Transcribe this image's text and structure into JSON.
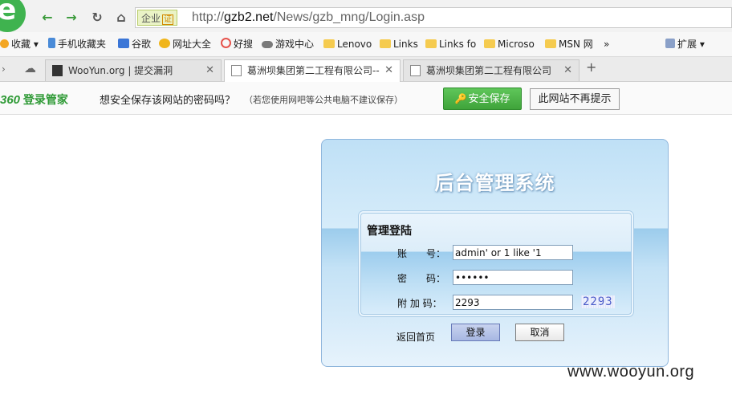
{
  "browser": {
    "address": {
      "security_badge": "企业",
      "security_tag": "证",
      "url_prefix": "http://",
      "url_host": "gzb2.net",
      "url_path": "/News/gzb_mng/Login.asp"
    },
    "bookmarks": {
      "favorites_label": "收藏",
      "items": [
        "手机收藏夹",
        "谷歌",
        "网址大全",
        "好搜",
        "游戏中心",
        "Lenovo",
        "Links",
        "Links fo",
        "Microso",
        "MSN 网"
      ],
      "overflow": "»",
      "extensions_label": "扩展"
    },
    "tabs": [
      {
        "title": "WooYun.org | 提交漏洞"
      },
      {
        "title": "葛洲坝集团第二工程有限公司--"
      },
      {
        "title": "葛洲坝集团第二工程有限公司"
      }
    ],
    "new_tab": "+",
    "password_bar": {
      "brand_number": "360",
      "brand_name": "登录管家",
      "question": "想安全保存该网站的密码吗？",
      "note": "（若您使用网吧等公共电脑不建议保存）",
      "save_label": "安全保存",
      "never_label": "此网站不再提示"
    }
  },
  "page": {
    "title": "后台管理系统",
    "box_title": "管理登陆",
    "form": {
      "account_label": "账　　号：",
      "account_value": "admin' or 1 like '1",
      "password_label": "密　　码：",
      "password_value": "••••••",
      "code_label": "附 加 码：",
      "code_value": "2293",
      "captcha": "2293"
    },
    "home_link": "返回首页",
    "login_button": "登录",
    "cancel_button": "取消"
  },
  "watermark": "www.wooyun.org",
  "colors": {
    "accent_green": "#3fa33a",
    "panel_blue": "#bfe0f6",
    "link_blue": "#4b5cc9"
  }
}
